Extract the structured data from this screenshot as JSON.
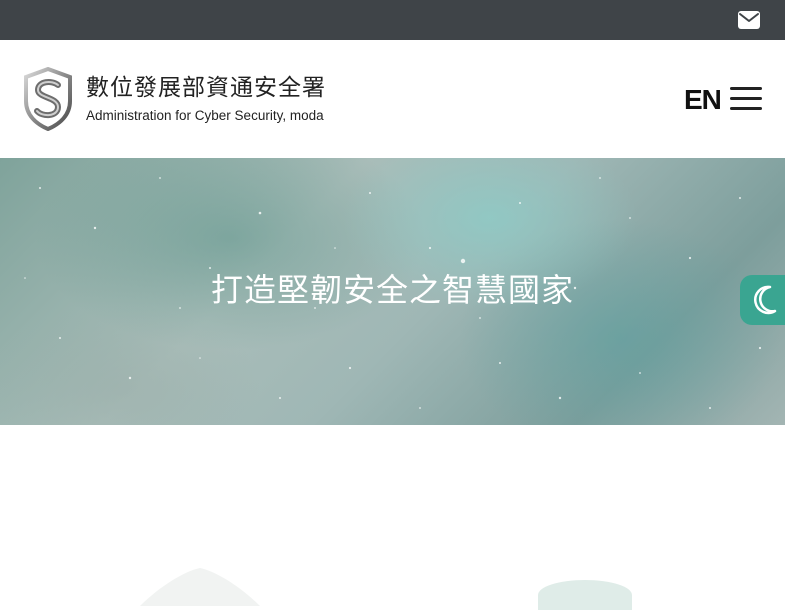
{
  "topbar": {
    "mail_icon": "mail-icon"
  },
  "header": {
    "logo": {
      "name_zh": "數位發展部資通安全署",
      "name_en": "Administration for Cyber Security, moda"
    },
    "language_toggle": "EN",
    "menu_icon": "hamburger-menu-icon"
  },
  "hero": {
    "slogan": "打造堅韌安全之智慧國家"
  },
  "theme_toggle": {
    "icon": "moon-icon"
  },
  "colors": {
    "topbar": "#3f4448",
    "accent": "#3aa591",
    "text": "#222222"
  }
}
